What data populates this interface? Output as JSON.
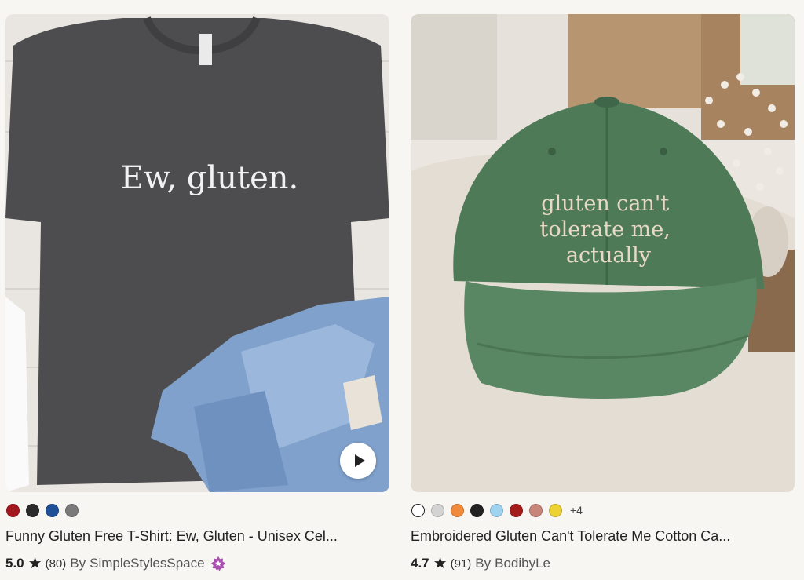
{
  "products": [
    {
      "title": "Funny Gluten Free T-Shirt: Ew, Gluten - Unisex Cel...",
      "image_text": "Ew, gluten.",
      "rating": "5.0",
      "reviews": "(80)",
      "shop_prefix": "By",
      "shop": "SimpleStylesSpace",
      "swatches": [
        "#a3171f",
        "#2b2b2b",
        "#1f4f97",
        "#7a7a7a"
      ],
      "has_video": true,
      "badge": "star-seller-badge"
    },
    {
      "title": "Embroidered Gluten Can't Tolerate Me Cotton Ca...",
      "image_text_lines": [
        "gluten can't",
        "tolerate me,",
        "actually"
      ],
      "rating": "4.7",
      "reviews": "(91)",
      "shop_prefix": "By",
      "shop": "BodibyLe",
      "swatches": [
        "#ffffff",
        "#d3d3d3",
        "#f08a3c",
        "#222222",
        "#9fd3f0",
        "#a41b1b",
        "#c8857a",
        "#ecd233"
      ],
      "more_colors": "+4"
    }
  ]
}
